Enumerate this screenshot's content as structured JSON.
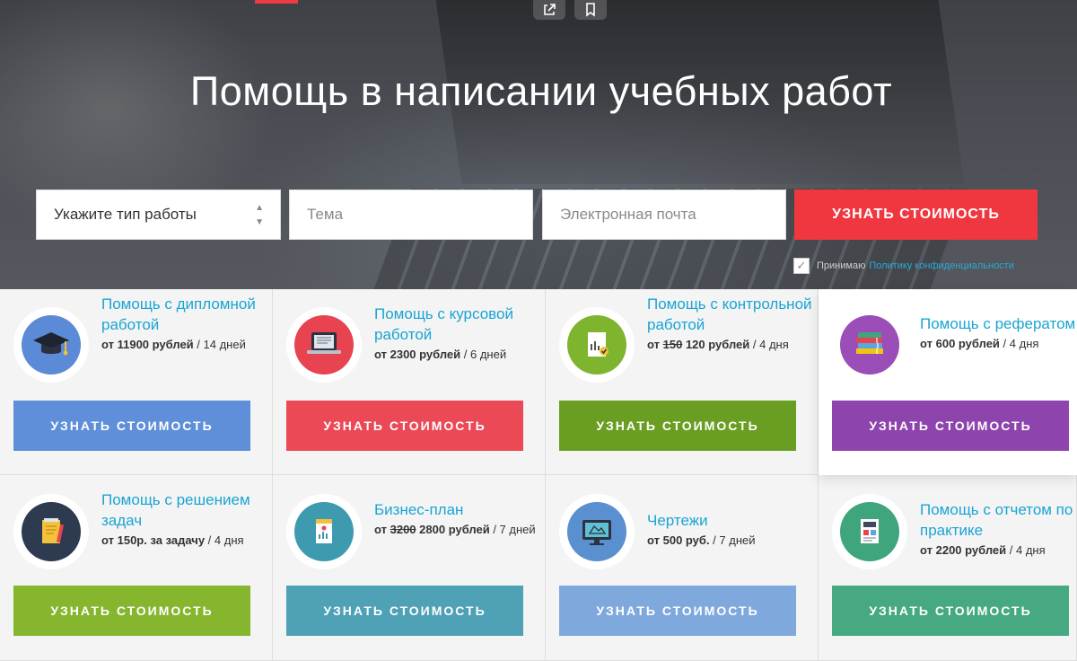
{
  "hero": {
    "title": "Помощь в написании учебных работ",
    "select_value": "Укажите тип работы",
    "topic_placeholder": "Тема",
    "email_placeholder": "Электронная почта",
    "submit_label": "УЗНАТЬ СТОИМОСТЬ",
    "consent_label": "Принимаю",
    "consent_link": "Политику конфиденциальности"
  },
  "colors": {
    "accent": "#f0373f",
    "link": "#1aa4d3"
  },
  "cards": [
    {
      "title": "Помощь с дипломной работой",
      "price_prefix": "от",
      "old_price": "",
      "price": "11900 рублей",
      "term": " / 14 дней",
      "button": "УЗНАТЬ СТОИМОСТЬ",
      "icon": "graduation-cap-icon",
      "circle_color": "#5b8ad6",
      "button_color": "#5f8fd8"
    },
    {
      "title": "Помощь с курсовой работой",
      "price_prefix": "от",
      "old_price": "",
      "price": "2300 рублей",
      "term": " / 6 дней",
      "button": "УЗНАТЬ СТОИМОСТЬ",
      "icon": "laptop-document-icon",
      "circle_color": "#e84350",
      "button_color": "#ec4957"
    },
    {
      "title": "Помощь с контрольной работой",
      "price_prefix": "от",
      "old_price": "150",
      "price": "120 рублей",
      "term": " / 4 дня",
      "button": "УЗНАТЬ СТОИМОСТЬ",
      "icon": "checked-report-icon",
      "circle_color": "#7fb42f",
      "button_color": "#6a9e22"
    },
    {
      "title": "Помощь с рефератом",
      "price_prefix": "от",
      "old_price": "",
      "price": "600 рублей",
      "term": " / 4 дня",
      "button": "УЗНАТЬ СТОИМОСТЬ",
      "icon": "book-stack-icon",
      "circle_color": "#9b4db8",
      "button_color": "#8e44ad"
    },
    {
      "title": "Помощь с решением задач",
      "price_prefix": "от",
      "old_price": "",
      "price": "150р. за задачу",
      "term": " / 4 дня",
      "button": "УЗНАТЬ СТОИМОСТЬ",
      "icon": "notepad-pencil-icon",
      "circle_color": "#2e3a50",
      "button_color": "#86b52e"
    },
    {
      "title": "Бизнес-план",
      "price_prefix": "от",
      "old_price": "3200",
      "price": "2800 рублей",
      "term": " / 7 дней",
      "button": "УЗНАТЬ СТОИМОСТЬ",
      "icon": "business-plan-icon",
      "circle_color": "#3e9aae",
      "button_color": "#4fa1b5"
    },
    {
      "title": "Чертежи",
      "price_prefix": "от",
      "old_price": "",
      "price": "500 руб.",
      "term": " / 7 дней",
      "button": "УЗНАТЬ СТОИМОСТЬ",
      "icon": "monitor-drawing-icon",
      "circle_color": "#5a8fd0",
      "button_color": "#7fa9dd"
    },
    {
      "title": "Помощь с отчетом по практике",
      "price_prefix": "от",
      "old_price": "",
      "price": "2200 рублей",
      "term": " / 4 дня",
      "button": "УЗНАТЬ СТОИМОСТЬ",
      "icon": "report-document-icon",
      "circle_color": "#3ea57c",
      "button_color": "#46a982"
    }
  ]
}
